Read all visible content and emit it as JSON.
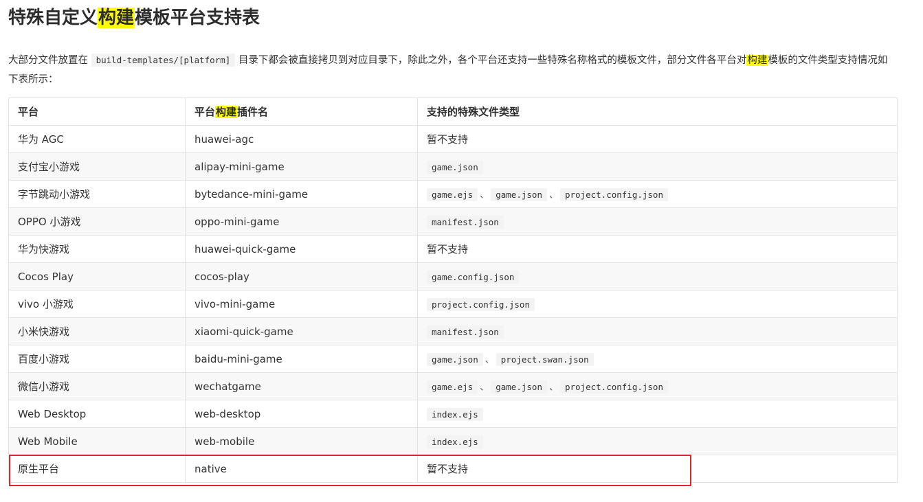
{
  "title": {
    "before": "特殊自定义",
    "highlight": "构建",
    "after": "模板平台支持表"
  },
  "intro": {
    "part1": "大部分文件放置在",
    "code": "build-templates/[platform]",
    "part2": "目录下都会被直接拷贝到对应目录下，除此之外，各个平台还支持一些特殊名称格式的模板文件，部分文件各平台对",
    "highlight": "构建",
    "part3": "模板的文件类型支持情况如下表所示："
  },
  "table": {
    "headers": {
      "platform": "平台",
      "plugin_before": "平台",
      "plugin_highlight": "构建",
      "plugin_after": "插件名",
      "files": "支持的特殊文件类型"
    },
    "separator": "、",
    "rows": [
      {
        "platform": "华为 AGC",
        "plugin": "huawei-agc",
        "unsupported": "暂不支持",
        "files": []
      },
      {
        "platform": "支付宝小游戏",
        "plugin": "alipay-mini-game",
        "files": [
          "game.json"
        ]
      },
      {
        "platform": "字节跳动小游戏",
        "plugin": "bytedance-mini-game",
        "files": [
          "game.ejs",
          "game.json",
          "project.config.json"
        ]
      },
      {
        "platform": "OPPO 小游戏",
        "plugin": "oppo-mini-game",
        "files": [
          "manifest.json"
        ]
      },
      {
        "platform": "华为快游戏",
        "plugin": "huawei-quick-game",
        "unsupported": "暂不支持",
        "files": []
      },
      {
        "platform": "Cocos Play",
        "plugin": "cocos-play",
        "files": [
          "game.config.json"
        ]
      },
      {
        "platform": "vivo 小游戏",
        "plugin": "vivo-mini-game",
        "files": [
          "project.config.json"
        ]
      },
      {
        "platform": "小米快游戏",
        "plugin": "xiaomi-quick-game",
        "files": [
          "manifest.json"
        ]
      },
      {
        "platform": "百度小游戏",
        "plugin": "baidu-mini-game",
        "files": [
          "game.json",
          "project.swan.json"
        ]
      },
      {
        "platform": "微信小游戏",
        "plugin": "wechatgame",
        "files": [
          "game.ejs",
          "game.json",
          "project.config.json"
        ]
      },
      {
        "platform": "Web Desktop",
        "plugin": "web-desktop",
        "files": [
          "index.ejs"
        ]
      },
      {
        "platform": "Web Mobile",
        "plugin": "web-mobile",
        "files": [
          "index.ejs"
        ]
      },
      {
        "platform": "原生平台",
        "plugin": "native",
        "unsupported": "暂不支持",
        "files": []
      }
    ]
  },
  "colors": {
    "highlight": "#ffff00",
    "annotation_box": "#e0262b"
  }
}
